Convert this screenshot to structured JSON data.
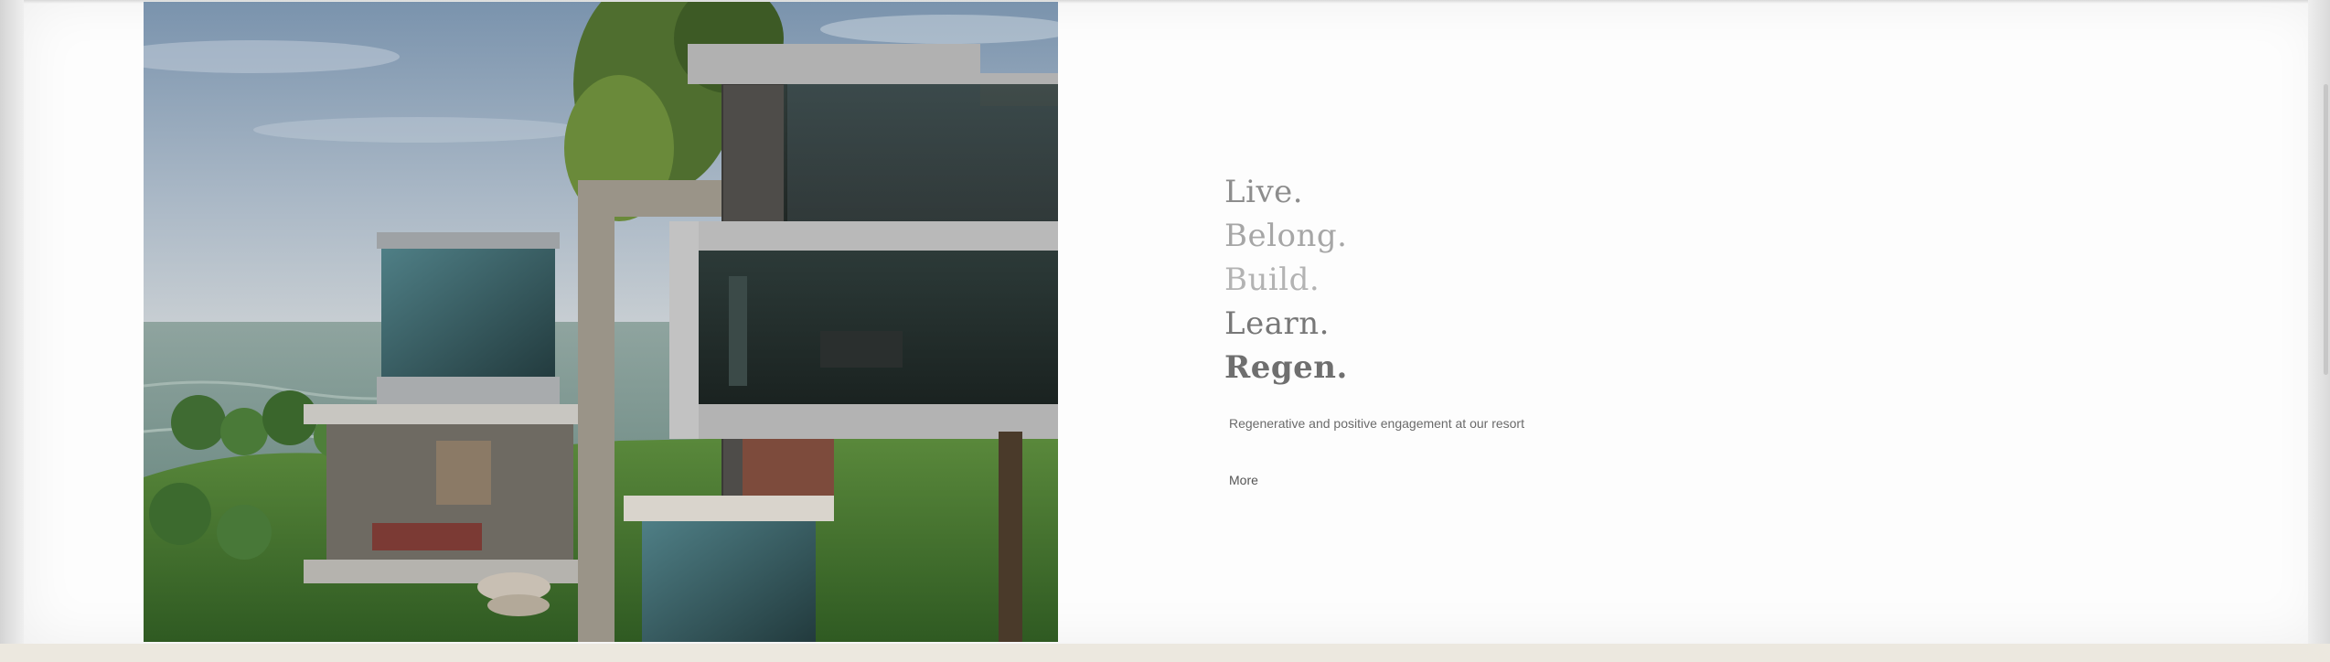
{
  "hero": {
    "image_alt": ""
  },
  "tagline": {
    "lines": [
      "Live.",
      "Belong.",
      "Build.",
      "Learn.",
      "Regen."
    ]
  },
  "description": "Regenerative and positive engagement at our resort",
  "more_label": "More"
}
